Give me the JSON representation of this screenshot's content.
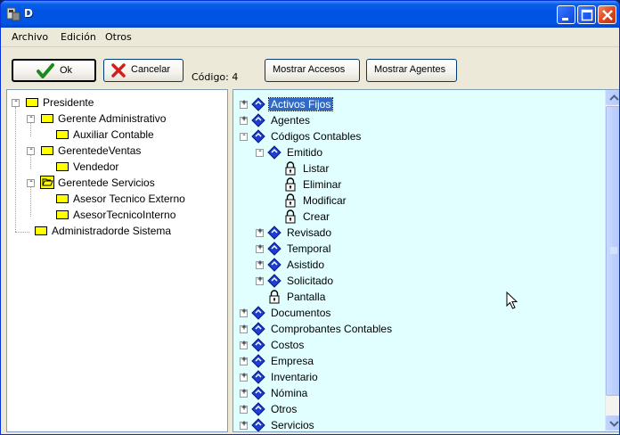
{
  "window": {
    "title": "D"
  },
  "menu": {
    "items": [
      "Archivo",
      "Edición",
      "Otros"
    ]
  },
  "toolbar": {
    "ok_label": "Ok",
    "cancel_label": "Cancelar",
    "code_label": "Código: 4",
    "show_access_label": "Mostrar Accesos",
    "show_agents_label": "Mostrar Agentes"
  },
  "left_tree": [
    {
      "label": "Presidente",
      "expander": "-"
    },
    {
      "label": "Gerente Administrativo",
      "expander": "-"
    },
    {
      "label": "Auxiliar Contable",
      "expander": ""
    },
    {
      "label": "GerentedeVentas",
      "expander": "-"
    },
    {
      "label": "Vendedor",
      "expander": ""
    },
    {
      "label": "Gerentede Servicios",
      "expander": "-"
    },
    {
      "label": "Asesor Tecnico Externo",
      "expander": ""
    },
    {
      "label": "AsesorTecnicoInterno",
      "expander": ""
    },
    {
      "label": "Administradorde Sistema",
      "expander": ""
    }
  ],
  "right_tree": [
    {
      "label": "Activos Fijos",
      "expander": "+",
      "selected": true
    },
    {
      "label": "Agentes",
      "expander": "+"
    },
    {
      "label": "Códigos Contables",
      "expander": "-"
    },
    {
      "label": "Emitido",
      "expander": "-"
    },
    {
      "label": "Listar",
      "expander": ""
    },
    {
      "label": "Eliminar",
      "expander": ""
    },
    {
      "label": "Modificar",
      "expander": ""
    },
    {
      "label": "Crear",
      "expander": ""
    },
    {
      "label": "Revisado",
      "expander": "+"
    },
    {
      "label": "Temporal",
      "expander": "+"
    },
    {
      "label": "Asistido",
      "expander": "+"
    },
    {
      "label": "Solicitado",
      "expander": "+"
    },
    {
      "label": "Pantalla",
      "expander": ""
    },
    {
      "label": "Documentos",
      "expander": "+"
    },
    {
      "label": "Comprobantes Contables",
      "expander": "+"
    },
    {
      "label": "Costos",
      "expander": "+"
    },
    {
      "label": "Empresa",
      "expander": "+"
    },
    {
      "label": "Inventario",
      "expander": "+"
    },
    {
      "label": "Nómina",
      "expander": "+"
    },
    {
      "label": "Otros",
      "expander": "+"
    },
    {
      "label": "Servicios",
      "expander": "+"
    }
  ],
  "colors": {
    "title_bar": "#0054e3",
    "right_pane_bg": "#e1ffff",
    "selection": "#316ac5",
    "group_icon": "#ffff00",
    "perm_icon": "#1c3ed8"
  },
  "icons": {
    "group": "yellow-rectangle-icon",
    "permission_group": "blue-diamond-icon",
    "permission": "padlock-icon"
  }
}
